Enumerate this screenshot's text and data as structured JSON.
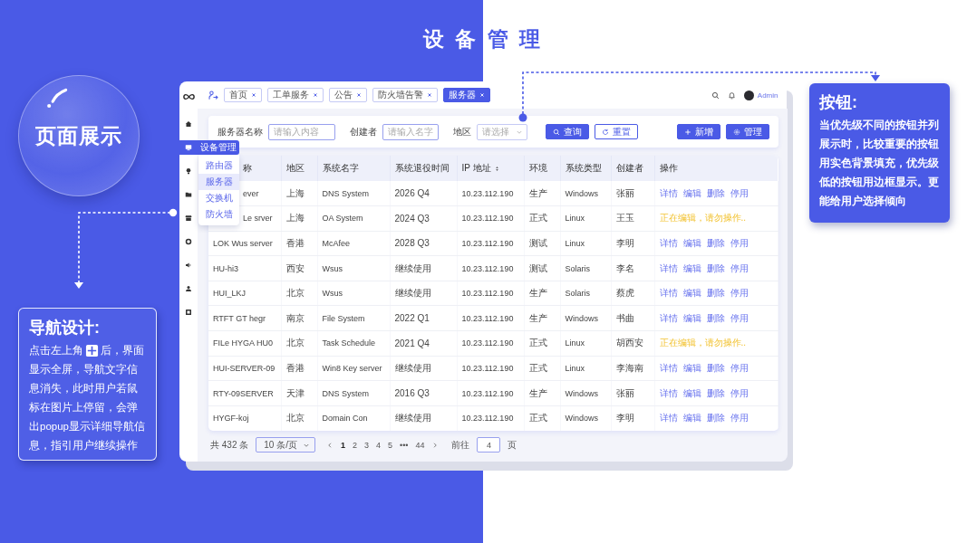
{
  "title": "设 备 管 理",
  "bubble": {
    "label": "页面展示"
  },
  "nav_note": {
    "heading": "导航设计:",
    "text_before_icon": "点击左上角",
    "text_after_icon": "后，界面",
    "text": "显示全屏，导航文字信息消失，此时用户若鼠标在图片上停留，会弹出popup显示详细导航信息，指引用户继续操作"
  },
  "button_note": {
    "heading": "按钮:",
    "text": "当优先级不同的按钮并列展示时，比较重要的按钮用实色背景填充，优先级低的按钮用边框显示。更能给用户选择倾向"
  },
  "app": {
    "tabs": [
      {
        "label": "首页",
        "selected": false
      },
      {
        "label": "工单服务",
        "selected": false
      },
      {
        "label": "公告",
        "selected": false
      },
      {
        "label": "防火墙告警",
        "selected": false
      },
      {
        "label": "服务器",
        "selected": true
      }
    ],
    "user": "Admin",
    "menu": {
      "label": "设备管理",
      "items": [
        {
          "label": "路由器",
          "selected": false
        },
        {
          "label": "服务器",
          "selected": true
        },
        {
          "label": "交换机",
          "selected": false
        },
        {
          "label": "防火墙",
          "selected": false
        }
      ]
    },
    "filters": [
      {
        "kind": "text",
        "label": "服务器名称",
        "placeholder": "请输入内容"
      },
      {
        "kind": "text",
        "label": "创建者",
        "placeholder": "请输入名字"
      },
      {
        "kind": "select",
        "label": "地区",
        "placeholder": "请选择"
      }
    ],
    "actions": [
      {
        "kind": "primary",
        "label": "查询"
      },
      {
        "kind": "outline",
        "label": "重置"
      }
    ],
    "right_actions": [
      {
        "kind": "primary",
        "label": "新增"
      },
      {
        "kind": "primary",
        "label": "管理"
      }
    ],
    "table": {
      "header_clipped": true,
      "columns": [
        "称",
        "地区",
        "系统名字",
        "系统退役时间",
        "IP 地址",
        "环境",
        "系统类型",
        "创建者",
        "操作"
      ],
      "rows": [
        {
          "clipped": true,
          "name": "ever",
          "region": "上海",
          "system": "DNS System",
          "retire": "2026 Q4",
          "ip": "10.23.112.190",
          "env": "生产",
          "os": "Windows",
          "creator": "张丽",
          "ops": {
            "kind": "links",
            "items": [
              "详情",
              "编辑",
              "删除",
              "停用"
            ]
          }
        },
        {
          "clipped": true,
          "name": "Le srver",
          "region": "上海",
          "system": "OA System",
          "retire": "2024 Q3",
          "ip": "10.23.112.190",
          "env": "正式",
          "os": "Linux",
          "creator": "王玉",
          "ops": {
            "kind": "notice",
            "text": "正在编辑，请勿操作.."
          }
        },
        {
          "clipped": false,
          "name": "LOK Wus server",
          "region": "香港",
          "system": "McAfee",
          "retire": "2028 Q3",
          "ip": "10.23.112.190",
          "env": "测试",
          "os": "Linux",
          "creator": "李明",
          "ops": {
            "kind": "links",
            "items": [
              "详情",
              "编辑",
              "删除",
              "停用"
            ]
          }
        },
        {
          "clipped": false,
          "name": "HU-hi3",
          "region": "西安",
          "system": "Wsus",
          "retire": "继续使用",
          "ip": "10.23.112.190",
          "env": "测试",
          "os": "Solaris",
          "creator": "李名",
          "ops": {
            "kind": "links",
            "items": [
              "详情",
              "编辑",
              "删除",
              "停用"
            ]
          }
        },
        {
          "clipped": false,
          "name": "HUI_LKJ",
          "region": "北京",
          "system": "Wsus",
          "retire": "继续使用",
          "ip": "10.23.112.190",
          "env": "生产",
          "os": "Solaris",
          "creator": "蔡虎",
          "ops": {
            "kind": "links",
            "items": [
              "详情",
              "编辑",
              "删除",
              "停用"
            ]
          }
        },
        {
          "clipped": false,
          "name": "RTFT GT hegr",
          "region": "南京",
          "system": "File System",
          "retire": "2022 Q1",
          "ip": "10.23.112.190",
          "env": "生产",
          "os": "Windows",
          "creator": "书曲",
          "ops": {
            "kind": "links",
            "items": [
              "详情",
              "编辑",
              "删除",
              "停用"
            ]
          }
        },
        {
          "clipped": false,
          "name": "FILe HYGA HU0",
          "region": "北京",
          "system": "Task Schedule",
          "retire": "2021 Q4",
          "ip": "10.23.112.190",
          "env": "正式",
          "os": "Linux",
          "creator": "胡西安",
          "ops": {
            "kind": "notice",
            "text": "正在编辑，请勿操作.."
          }
        },
        {
          "clipped": false,
          "name": "HUI-SERVER-09",
          "region": "香港",
          "system": "Win8 Key server",
          "retire": "继续使用",
          "ip": "10.23.112.190",
          "env": "正式",
          "os": "Linux",
          "creator": "李海南",
          "ops": {
            "kind": "links",
            "items": [
              "详情",
              "编辑",
              "删除",
              "停用"
            ]
          }
        },
        {
          "clipped": false,
          "name": "RTY-09SERVER",
          "region": "天津",
          "system": "DNS System",
          "retire": "2016 Q3",
          "ip": "10.23.112.190",
          "env": "生产",
          "os": "Windows",
          "creator": "张丽",
          "ops": {
            "kind": "links",
            "items": [
              "详情",
              "编辑",
              "删除",
              "停用"
            ]
          }
        },
        {
          "clipped": false,
          "name": "HYGF-koj",
          "region": "北京",
          "system": "Domain Con",
          "retire": "继续使用",
          "ip": "10.23.112.190",
          "env": "正式",
          "os": "Windows",
          "creator": "李明",
          "ops": {
            "kind": "links",
            "items": [
              "详情",
              "编辑",
              "删除",
              "停用"
            ]
          }
        }
      ]
    },
    "pager": {
      "total": "共 432 条",
      "size": "10 条/页",
      "pages": [
        {
          "label": "1",
          "selected": true
        },
        {
          "label": "2",
          "selected": false
        },
        {
          "label": "3",
          "selected": false
        },
        {
          "label": "4",
          "selected": false
        },
        {
          "label": "5",
          "selected": false
        },
        {
          "label": "•••",
          "selected": false
        },
        {
          "label": "44",
          "selected": false
        }
      ],
      "goto_label": "前往",
      "goto_value": "4",
      "unit": "页"
    }
  }
}
